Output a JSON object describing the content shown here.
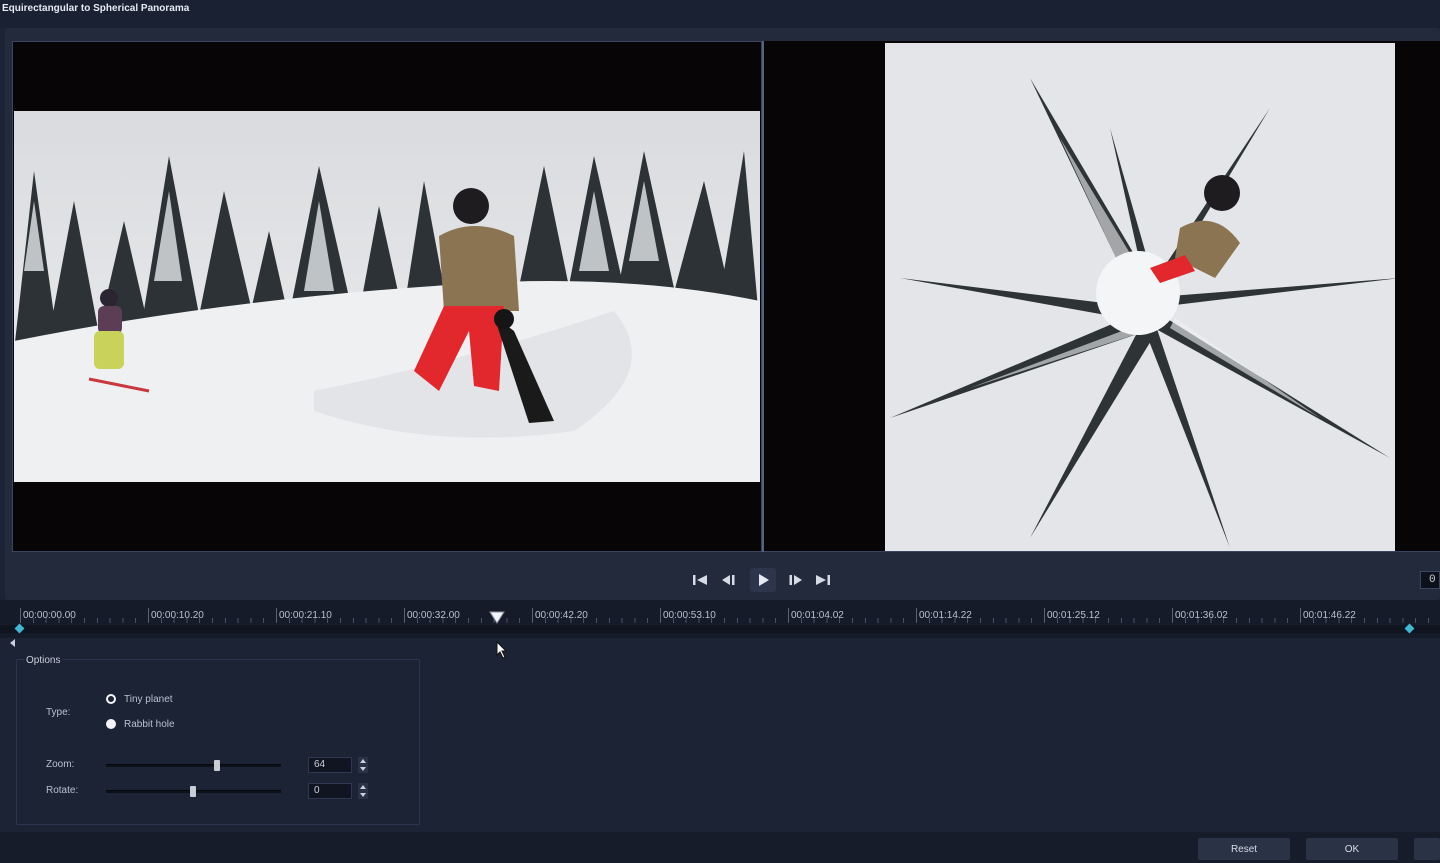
{
  "window": {
    "title": "Equirectangular to Spherical Panorama"
  },
  "transport": {
    "buttons": [
      {
        "name": "go-to-start",
        "icon": "skip-start-icon"
      },
      {
        "name": "previous-frame",
        "icon": "step-back-icon"
      },
      {
        "name": "play",
        "icon": "play-icon"
      },
      {
        "name": "next-frame",
        "icon": "step-forward-icon"
      },
      {
        "name": "go-to-end",
        "icon": "skip-end-icon"
      }
    ],
    "timecode": "0"
  },
  "timeline": {
    "labels": [
      "00:00:00.00",
      "00:00:10.20",
      "00:00:21.10",
      "00:00:32.00",
      "00:00:42.20",
      "00:00:53.10",
      "00:01:04.02",
      "00:01:14.22",
      "00:01:25.12",
      "00:01:36.02",
      "00:01:46.22"
    ],
    "marker_color": "#3fb8d6"
  },
  "options": {
    "section_label": "Options",
    "type_label": "Type:",
    "type_options": [
      "Tiny planet",
      "Rabbit hole"
    ],
    "type_selected": "Tiny planet",
    "zoom_label": "Zoom:",
    "zoom_value": "64",
    "rotate_label": "Rotate:",
    "rotate_value": "0"
  },
  "footer": {
    "reset_label": "Reset",
    "ok_label": "OK"
  }
}
